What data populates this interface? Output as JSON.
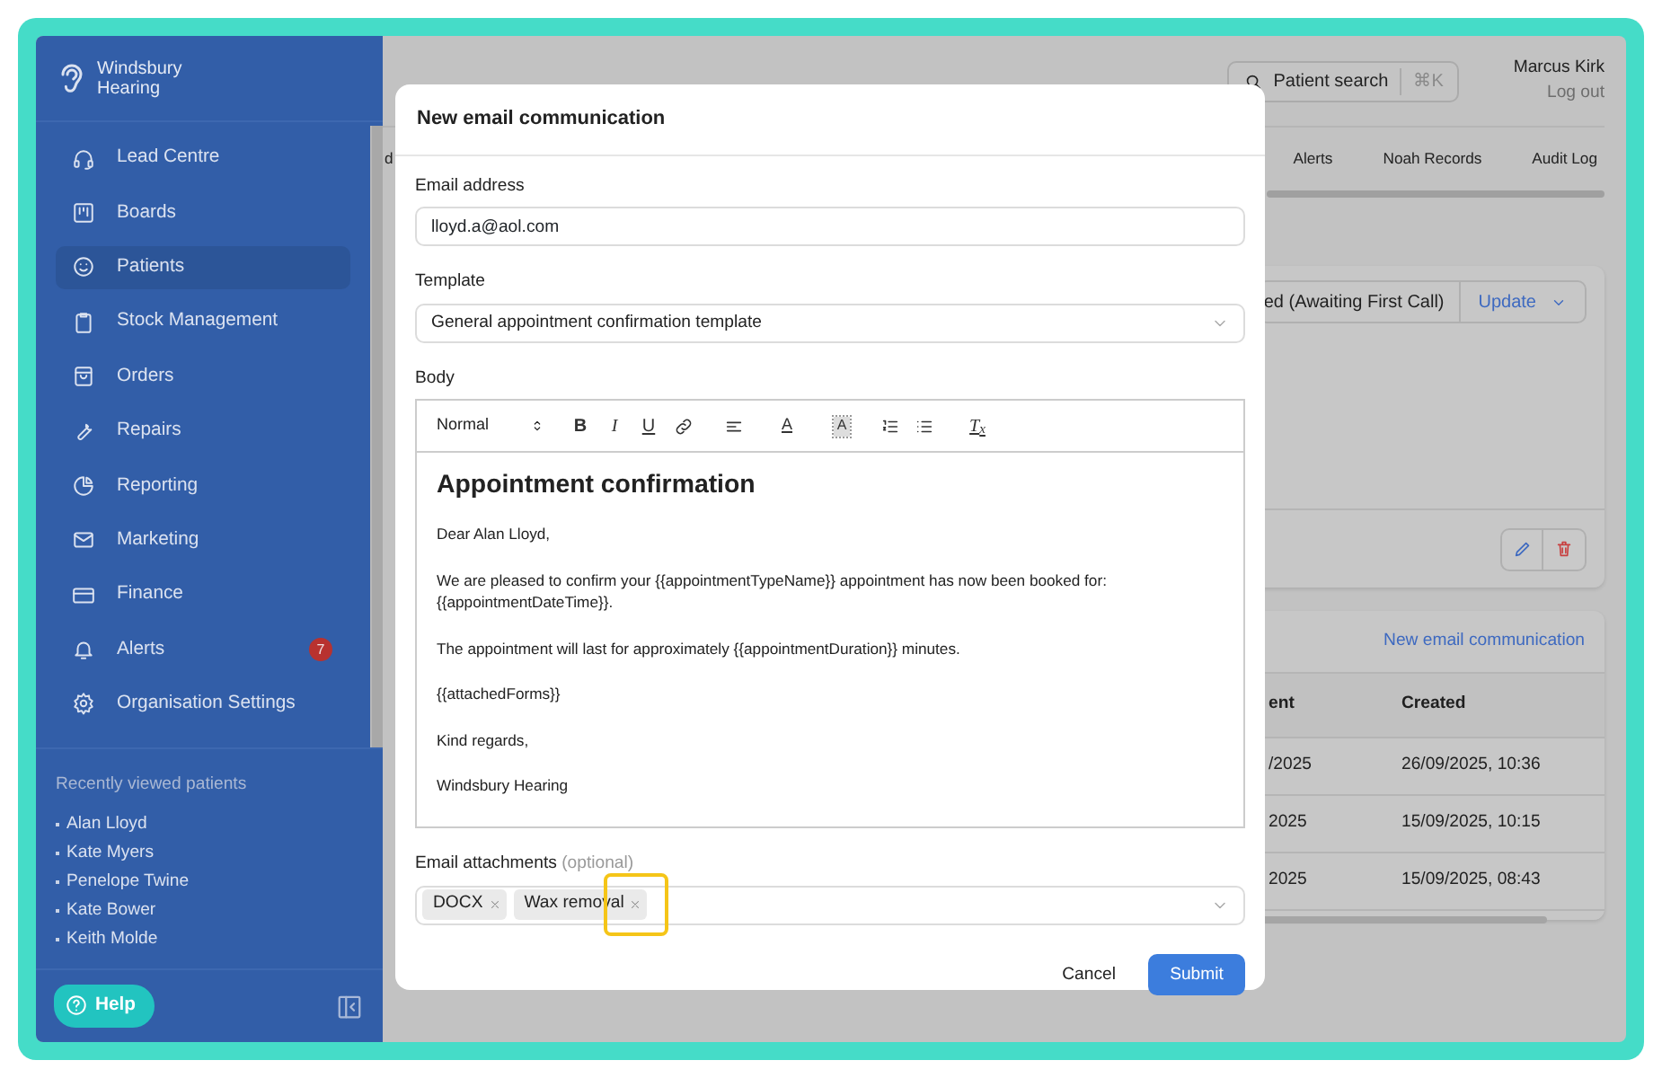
{
  "sidebar": {
    "logo_lines": [
      "Windsbury",
      "Hearing"
    ],
    "nav": [
      {
        "label": "Lead Centre",
        "selected": false
      },
      {
        "label": "Boards",
        "selected": false
      },
      {
        "label": "Patients",
        "selected": true
      },
      {
        "label": "Stock Management",
        "selected": false
      },
      {
        "label": "Orders",
        "selected": false
      },
      {
        "label": "Repairs",
        "selected": false
      },
      {
        "label": "Reporting",
        "selected": false
      },
      {
        "label": "Marketing",
        "selected": false
      },
      {
        "label": "Finance",
        "selected": false
      },
      {
        "label": "Alerts",
        "selected": false,
        "badge": "7"
      },
      {
        "label": "Organisation Settings",
        "selected": false
      }
    ],
    "recent_heading": "Recently viewed patients",
    "recent_patients": [
      "Alan Lloyd",
      "Kate Myers",
      "Penelope Twine",
      "Kate Bower",
      "Keith Molde"
    ],
    "help_button": "Help"
  },
  "header": {
    "search_label": "Patient search",
    "search_shortcut": "⌘K",
    "user_name": "Marcus Kirk",
    "logout": "Log out"
  },
  "tabs": [
    {
      "label": "d"
    },
    {
      "label": "Alerts"
    },
    {
      "label": "Noah Records"
    },
    {
      "label": "Audit Log"
    }
  ],
  "status_card": {
    "status": "ed (Awaiting First Call)",
    "update_button": "Update"
  },
  "communications": {
    "link": "New email communication",
    "columns": [
      "ent",
      "Created"
    ],
    "rows": [
      [
        "/2025",
        "26/09/2025, 10:36"
      ],
      [
        "2025",
        "15/09/2025, 10:15"
      ],
      [
        "2025",
        "15/09/2025, 08:43"
      ]
    ]
  },
  "modal": {
    "title": "New email communication",
    "fields": [
      {
        "label": "Email address",
        "value": "lloyd.a@aol.com",
        "kind": "input"
      },
      {
        "label": "Template",
        "value": "General appointment confirmation template",
        "kind": "select"
      }
    ],
    "body": {
      "label": "Body",
      "format": "Normal",
      "toolbar": [
        {
          "kind": "bold",
          "label": "B"
        },
        {
          "kind": "italic",
          "label": "I"
        },
        {
          "kind": "underline",
          "label": "U"
        },
        {
          "kind": "link"
        },
        {
          "kind": "align"
        },
        {
          "kind": "color",
          "label": "A"
        },
        {
          "kind": "background",
          "label": "A"
        },
        {
          "kind": "ordered-list"
        },
        {
          "kind": "bullet-list"
        },
        {
          "kind": "clean",
          "label": "T$_{x}$"
        }
      ],
      "heading": "Appointment confirmation",
      "paragraphs": [
        "Dear Alan Lloyd,",
        "We are pleased to confirm your {{appointmentTypeName}} appointment has now been booked for: {{appointmentDateTime}}.",
        "The appointment will last for approximately {{appointmentDuration}} minutes.",
        "{{attachedForms}}",
        "Kind regards,",
        "Windsbury Hearing"
      ]
    },
    "attachments": {
      "label": "Email attachments",
      "hint": "(optional)",
      "chips": [
        {
          "label": "DOCX",
          "highlighted": false
        },
        {
          "label": "Wax removal",
          "highlighted": true
        }
      ]
    },
    "cancel_button": "Cancel",
    "submit_button": "Submit"
  }
}
